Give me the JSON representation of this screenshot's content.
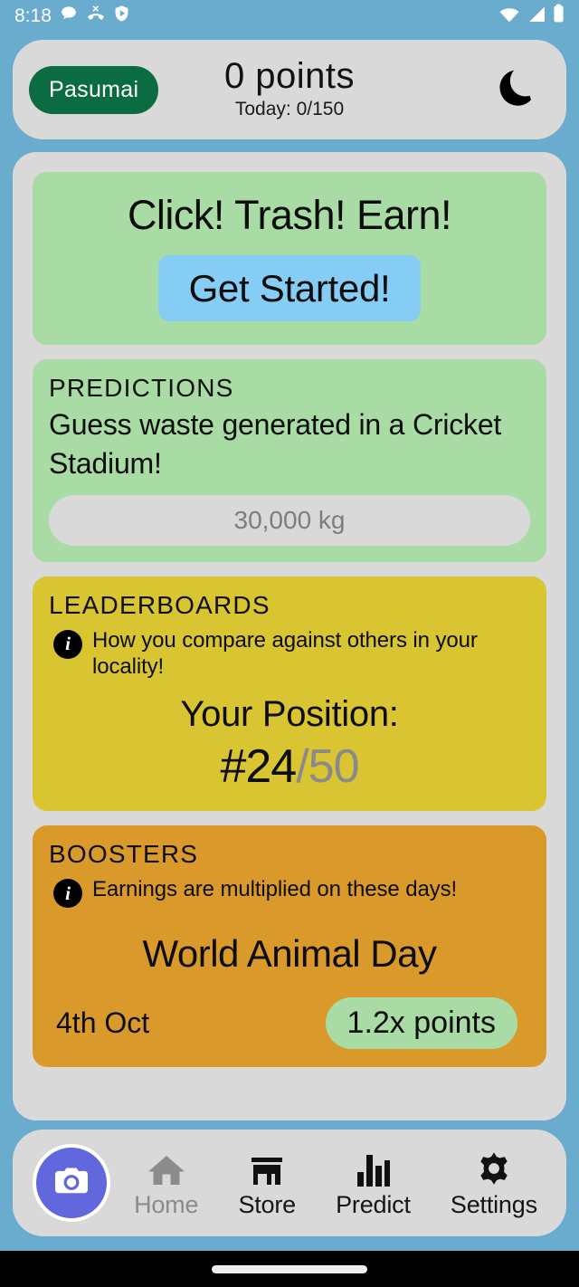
{
  "status_bar": {
    "time": "8:18",
    "left_icons": [
      "chat-bubble-icon",
      "missed-call-icon",
      "shield-play-icon"
    ],
    "right_icons": [
      "wifi-icon",
      "cellular-signal-icon",
      "battery-icon"
    ]
  },
  "header": {
    "brand_label": "Pasumai",
    "points_value": "0 points",
    "points_today": "Today: 0/150",
    "theme_toggle_icon": "crescent-moon-icon"
  },
  "hero": {
    "title": "Click! Trash! Earn!",
    "cta_label": "Get Started!"
  },
  "predictions": {
    "section_label": "PREDICTIONS",
    "prompt": "Guess waste generated in a Cricket Stadium!",
    "input_value": "",
    "input_placeholder": "30,000 kg"
  },
  "leaderboards": {
    "section_label": "LEADERBOARDS",
    "info_icon": "info-icon",
    "info_text": "How you compare against others in your locality!",
    "position_title": "Your Position:",
    "position_rank": "#24",
    "position_total": "/50"
  },
  "boosters": {
    "section_label": "BOOSTERS",
    "info_icon": "info-icon",
    "info_text": "Earnings are multiplied on these days!",
    "event_name": "World Animal Day",
    "event_date": "4th Oct",
    "multiplier_badge": "1.2x points"
  },
  "bottom_nav": {
    "camera_button_icon": "camera-icon",
    "items": [
      {
        "label": "Home",
        "icon": "home-icon",
        "active": true
      },
      {
        "label": "Store",
        "icon": "storefront-icon",
        "active": false
      },
      {
        "label": "Predict",
        "icon": "bar-chart-icon",
        "active": false
      },
      {
        "label": "Settings",
        "icon": "gear-icon",
        "active": false
      }
    ]
  },
  "colors": {
    "page_background": "#6aacce",
    "surface": "#d9d9d9",
    "brand_green": "#0b6b41",
    "card_green": "#a9dba5",
    "cta_blue": "#86cdf5",
    "card_yellow": "#d9c431",
    "card_orange": "#d99a2b",
    "fab_indigo": "#6168dd",
    "muted_text": "#8a8a8a"
  }
}
